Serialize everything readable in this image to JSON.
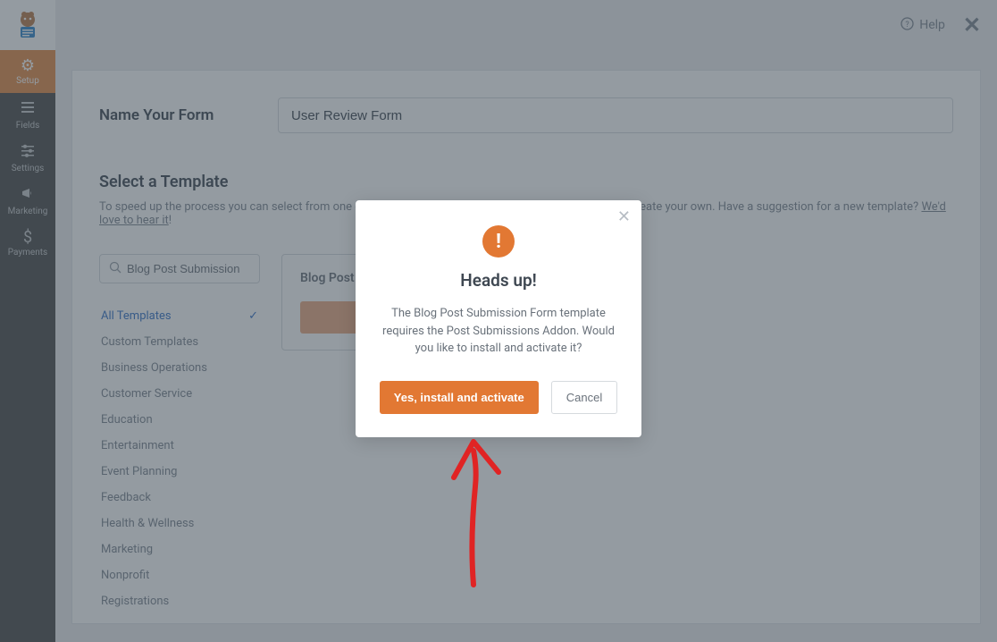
{
  "topbar": {
    "help_label": "Help"
  },
  "sidebar": {
    "items": [
      {
        "label": "Setup",
        "active": true,
        "icon": "gear"
      },
      {
        "label": "Fields",
        "active": false,
        "icon": "list"
      },
      {
        "label": "Settings",
        "active": false,
        "icon": "sliders"
      },
      {
        "label": "Marketing",
        "active": false,
        "icon": "megaphone"
      },
      {
        "label": "Payments",
        "active": false,
        "icon": "dollar"
      }
    ]
  },
  "form": {
    "name_label": "Name Your Form",
    "name_value": "User Review Form"
  },
  "template_section": {
    "title": "Select a Template",
    "description_prefix": "To speed up the process you can select from one of our pre-made templates, start with a blank form or create your own. Have a suggestion for a new template? ",
    "description_link": "We'd love to hear it",
    "description_suffix": "!",
    "search_value": "Blog Post Submission",
    "categories": [
      "All Templates",
      "Custom Templates",
      "Business Operations",
      "Customer Service",
      "Education",
      "Entertainment",
      "Event Planning",
      "Feedback",
      "Health & Wellness",
      "Marketing",
      "Nonprofit",
      "Registrations"
    ],
    "active_category_index": 0,
    "card_title": "Blog Post Submission Form"
  },
  "modal": {
    "title": "Heads up!",
    "body": "The Blog Post Submission Form template requires the Post Submissions Addon. Would you like to install and activate it?",
    "confirm_label": "Yes, install and activate",
    "cancel_label": "Cancel"
  }
}
